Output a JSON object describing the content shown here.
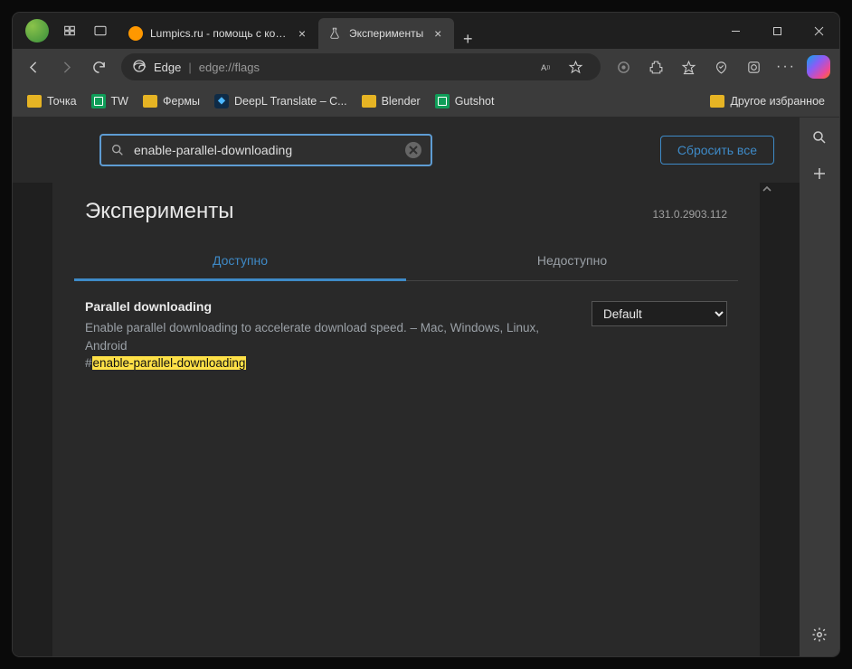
{
  "tabs": [
    {
      "label": "Lumpics.ru - помощь с компьюте"
    },
    {
      "label": "Эксперименты"
    }
  ],
  "addr": {
    "name": "Edge",
    "url": "edge://flags"
  },
  "bookmarks": {
    "items": [
      {
        "label": "Точка"
      },
      {
        "label": "TW"
      },
      {
        "label": "Фермы"
      },
      {
        "label": "DeepL Translate – С..."
      },
      {
        "label": "Blender"
      },
      {
        "label": "Gutshot"
      }
    ],
    "other": "Другое избранное"
  },
  "flags": {
    "search_value": "enable-parallel-downloading",
    "reset": "Сбросить все",
    "title": "Эксперименты",
    "version": "131.0.2903.112",
    "tab_available": "Доступно",
    "tab_unavailable": "Недоступно",
    "item": {
      "title": "Parallel downloading",
      "desc": "Enable parallel downloading to accelerate download speed. – Mac, Windows, Linux, Android",
      "hash": "#",
      "id": "enable-parallel-downloading",
      "select_value": "Default"
    }
  }
}
